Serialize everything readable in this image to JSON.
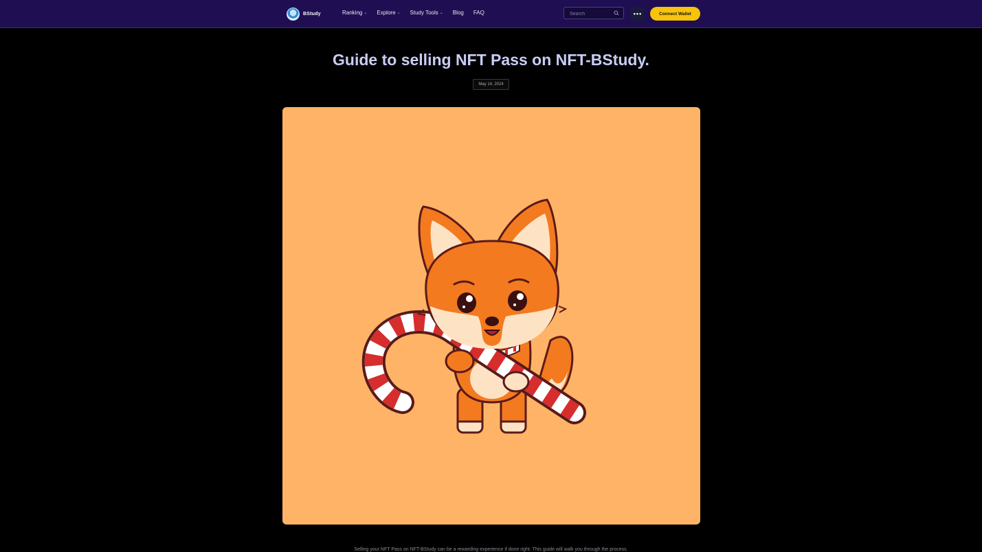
{
  "header": {
    "logo_text": "BStudy",
    "nav": [
      {
        "label": "Ranking",
        "has_dropdown": true
      },
      {
        "label": "Explore",
        "has_dropdown": true
      },
      {
        "label": "Study Tools",
        "has_dropdown": true
      },
      {
        "label": "Blog",
        "has_dropdown": false
      },
      {
        "label": "FAQ",
        "has_dropdown": false
      }
    ],
    "search": {
      "placeholder": "Search",
      "value": ""
    },
    "more_label": "•••",
    "wallet_label": "Connect Wallet"
  },
  "article": {
    "title": "Guide to selling NFT Pass on NFT-BStudy.",
    "date": "May 14, 2024",
    "intro": "Selling your NFT Pass on NFT-BStudy can be a rewarding experience if done right. This guide will walk you through the process."
  },
  "colors": {
    "header_bg": "#1f0f52",
    "wallet_button": "#f7c30b",
    "title": "#c9cdf4",
    "hero_bg": "#ffb366"
  }
}
